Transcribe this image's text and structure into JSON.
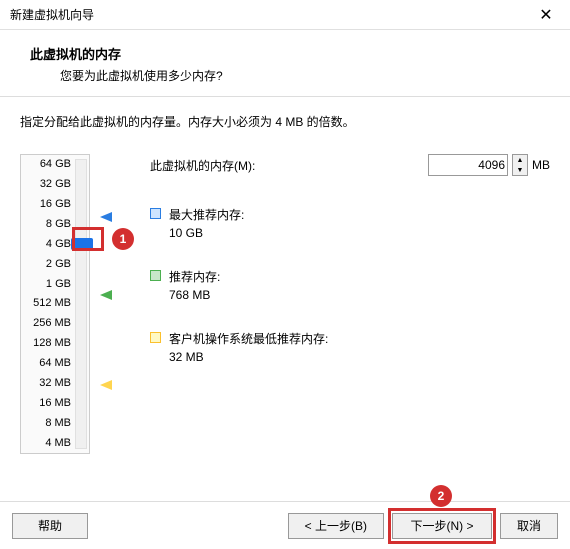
{
  "window": {
    "title": "新建虚拟机向导"
  },
  "header": {
    "title": "此虚拟机的内存",
    "subtitle": "您要为此虚拟机使用多少内存?"
  },
  "instruction": "指定分配给此虚拟机的内存量。内存大小必须为 4 MB 的倍数。",
  "scale": {
    "labels": [
      "64 GB",
      "32 GB",
      "16 GB",
      "8 GB",
      "4 GB",
      "2 GB",
      "1 GB",
      "512 MB",
      "256 MB",
      "128 MB",
      "64 MB",
      "32 MB",
      "16 MB",
      "8 MB",
      "4 MB"
    ]
  },
  "memory": {
    "label": "此虚拟机的内存(M):",
    "value": "4096",
    "unit": "MB"
  },
  "recommendations": {
    "max": {
      "label": "最大推荐内存:",
      "value": "10 GB",
      "color": "#2a7de1"
    },
    "recommended": {
      "label": "推荐内存:",
      "value": "768 MB",
      "color": "#4caf50"
    },
    "min": {
      "label": "客户机操作系统最低推荐内存:",
      "value": "32 MB",
      "color": "#ffd54f"
    }
  },
  "buttons": {
    "help": "帮助",
    "back": "< 上一步(B)",
    "next": "下一步(N) >",
    "cancel": "取消"
  },
  "annotations": {
    "one": "1",
    "two": "2"
  }
}
